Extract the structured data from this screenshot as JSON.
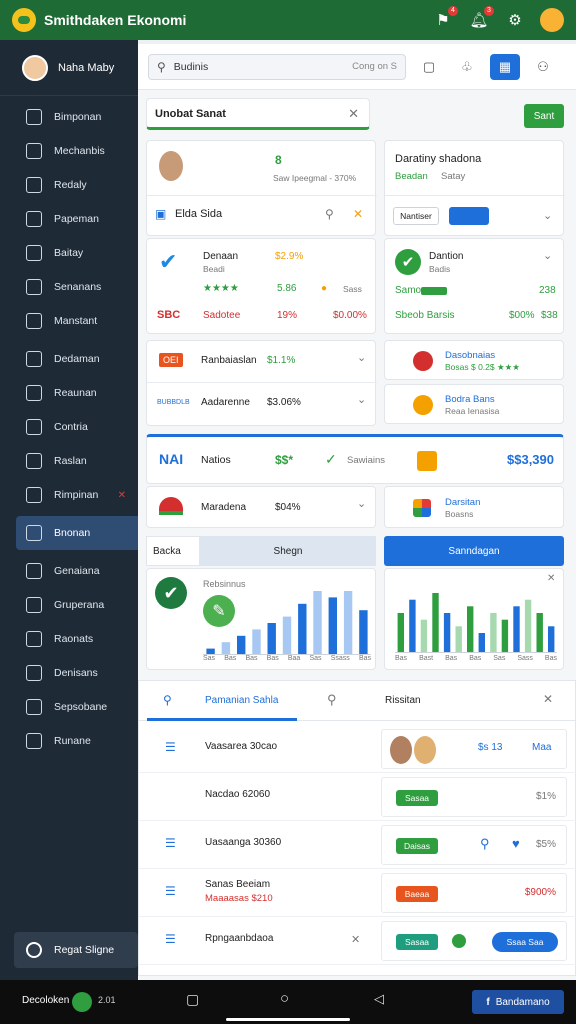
{
  "app": {
    "title": "Smithdaken Ekonomi"
  },
  "top_icons": [
    {
      "name": "flag-icon",
      "badge": "4"
    },
    {
      "name": "bell-icon",
      "badge": "3"
    },
    {
      "name": "gear-icon",
      "badge": ""
    }
  ],
  "sidebar": {
    "profile_name": "Naha Maby",
    "items": [
      {
        "label": "Bimponan",
        "icon": "grid-icon"
      },
      {
        "label": "Mechanbis",
        "icon": "clock-icon"
      },
      {
        "label": "Redaly",
        "icon": "wrench-icon"
      },
      {
        "label": "Papeman",
        "icon": "document-icon"
      },
      {
        "label": "Baitay",
        "icon": "chart-icon"
      },
      {
        "label": "Senanans",
        "icon": "calendar-icon"
      },
      {
        "label": "Manstant",
        "icon": "flag-icon"
      },
      {
        "label": "Dedaman",
        "icon": "dollar-icon"
      },
      {
        "label": "Reaunan",
        "icon": "tag-icon"
      },
      {
        "label": "Contria",
        "icon": "play-icon"
      },
      {
        "label": "Raslan",
        "icon": "heart-icon"
      },
      {
        "label": "Rimpinan",
        "icon": "settings-icon",
        "mark": "x"
      },
      {
        "label": "Bnonan",
        "icon": "list-icon",
        "active": true
      },
      {
        "label": "Genaiana",
        "icon": "shield-icon"
      },
      {
        "label": "Gruperana",
        "icon": "avatar-icon"
      },
      {
        "label": "Raonats",
        "icon": "box-icon"
      },
      {
        "label": "Denisans",
        "icon": "pin-icon"
      },
      {
        "label": "Sepsobane",
        "icon": "chat-icon"
      },
      {
        "label": "Runane",
        "icon": "layers-icon"
      }
    ],
    "footer_label": "Regat Sligne"
  },
  "search": {
    "value": "Budinis",
    "hint": "Cong on S"
  },
  "tab_input": {
    "value": "Unobat Sanat"
  },
  "go_button": "Sant",
  "profile_card": {
    "badge": "8",
    "subtext": "Saw Ipeegmal - 370%"
  },
  "right_card": {
    "title": "Daratiny shadona",
    "subtitle": "Beadan",
    "sub2": "Satay"
  },
  "row_label": "Elda Sida",
  "filter_button": "Nantiser",
  "cards_a": {
    "left": {
      "title": "Denaan",
      "subtitle": "Beadi",
      "percent": "$2.9%",
      "stars": "★★★★",
      "mid": "5.86",
      "tag": "Sass",
      "code": "SBC",
      "name": "Sadotee",
      "pct": "19%",
      "value": "$0.00%"
    },
    "right": {
      "title": "Dantion",
      "subtitle": "Badis",
      "bar_label": "Samo",
      "bar_value": "238",
      "total_label": "Sbeob Barsis",
      "total_pct": "$00%",
      "total_value": "$38"
    }
  },
  "list_a": [
    {
      "code": "OEI",
      "name": "Ranbaiaslan",
      "value": "$1.1%"
    },
    {
      "code": "BUBBDLB",
      "name": "Aadarenne",
      "value": "$3.06%"
    }
  ],
  "list_b": [
    {
      "title": "Dasobnaias",
      "subtitle": "Bosas $ 0.2$ ★★★"
    },
    {
      "title": "Bodra Bans",
      "subtitle": "Reaa Ienasisa"
    }
  ],
  "row_c": {
    "logo": "NAI",
    "name": "Natios",
    "chips": "$$*",
    "verify": "Sawiains",
    "total": "$$3,390"
  },
  "row_d": {
    "name": "Maradena",
    "value": "$04%",
    "right_title": "Darsitan",
    "right_sub": "Boasns"
  },
  "tabs_e": {
    "left_tab": "Backa",
    "mid_tab": "Shegn",
    "action": "Sanndagan"
  },
  "chart_left": {
    "label": "Rebsinnus",
    "ticks": [
      "Sas",
      "Bas",
      "Bas",
      "Bas",
      "Baa",
      "Sas",
      "Ssass",
      "Bas"
    ]
  },
  "chart_data": [
    {
      "type": "bar",
      "categories": [
        "Sas",
        "Bas",
        "Bas",
        "Bas",
        "Baa",
        "Sas",
        "Ssass",
        "Bas"
      ],
      "values": [
        1,
        2,
        3,
        4,
        5,
        6,
        8,
        10,
        9,
        10,
        7
      ],
      "title": "",
      "colors": [
        "#1e6fd9",
        "#a6c8f3"
      ]
    },
    {
      "type": "bar",
      "categories": [
        "Bas",
        "Bast",
        "Bas",
        "Bas",
        "Sas",
        "Sass",
        "Bas"
      ],
      "values": [
        6,
        8,
        5,
        9,
        6,
        4,
        7,
        3,
        6,
        5,
        7,
        8,
        6,
        4
      ],
      "title": "",
      "colors": [
        "#2e9e3e",
        "#1e6fd9",
        "#a6d9ae"
      ]
    }
  ],
  "chart_right": {
    "ticks": [
      "Bas",
      "Bast",
      "Bas",
      "Bas",
      "Sas",
      "Sass",
      "Bas"
    ]
  },
  "panel_tabs": {
    "active": "Pamanian Sahla",
    "right": "Rissitan"
  },
  "panel_rows": [
    {
      "left": "Vaasarea 30cao",
      "right_value": "$s 13",
      "right_value2": "Maa"
    },
    {
      "left": "Nacdao 62060",
      "right_pill": "Sasaa",
      "right_value": "$1%"
    },
    {
      "left": "Uasaanga 30360",
      "right_pill": "Daisas",
      "right_value": "$5%"
    },
    {
      "left": "Sanas Beeiam",
      "left2": "Maaaasas $210",
      "right_pill": "Baeaa",
      "right_value": "$900%"
    },
    {
      "left": "Rpngaanbdaoa",
      "right_pill": "Sasaa",
      "right_button": "Ssaa Saa"
    }
  ],
  "bottom_bar": {
    "left_label": "Decoloken",
    "left_value": "2.01",
    "fb_label": "Bandamano"
  }
}
